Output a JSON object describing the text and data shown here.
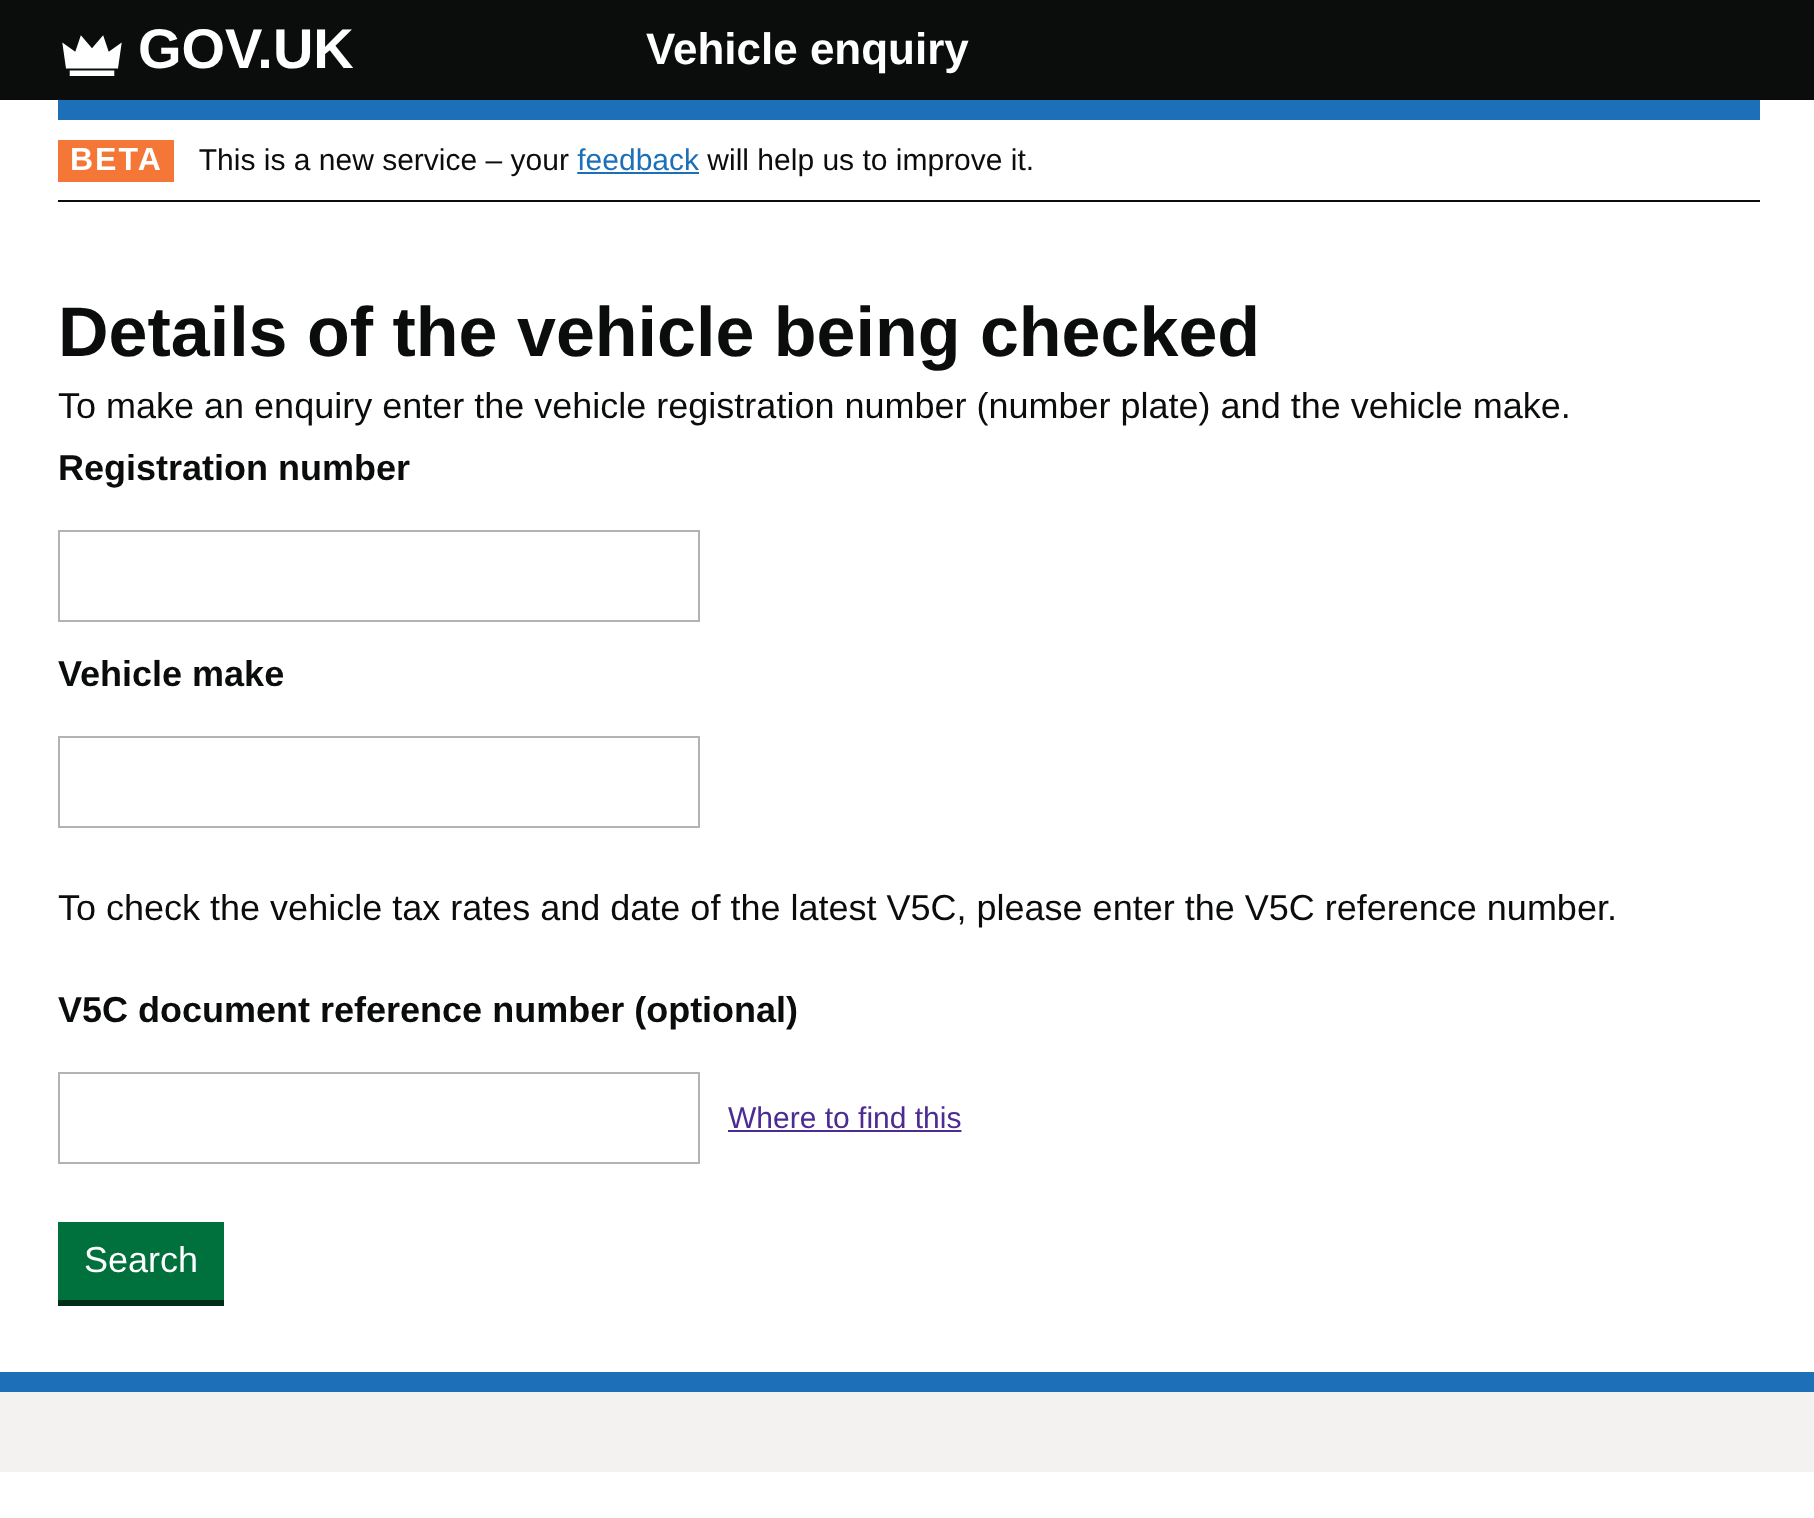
{
  "header": {
    "logo": "GOV.UK",
    "service": "Vehicle enquiry"
  },
  "phase_banner": {
    "tag": "BETA",
    "text_before": "This is a new service – your ",
    "link": "feedback",
    "text_after": " will help us to improve it."
  },
  "heading": "Details of the vehicle being checked",
  "intro": "To make an enquiry enter the vehicle registration number (number plate) and the vehicle make.",
  "fields": [
    {
      "label": "Registration number"
    },
    {
      "label": "Vehicle make"
    }
  ],
  "v5c_note": "To check the vehicle tax rates and date of the latest V5C, please enter the V5C reference number.",
  "v5c_field": {
    "label": "V5C document reference number (optional)",
    "help_link": "Where to find this"
  },
  "button": "Search"
}
